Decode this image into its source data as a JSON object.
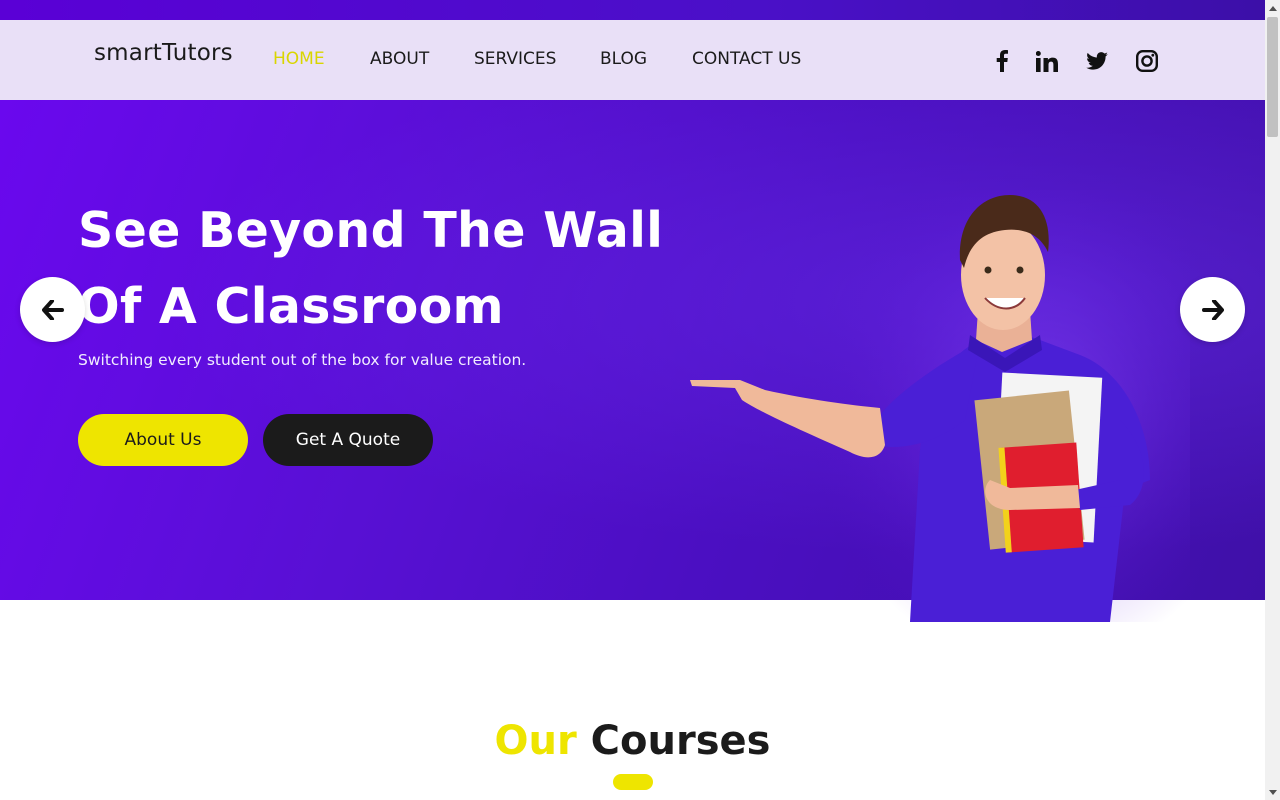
{
  "brand": {
    "name": "smartTutors"
  },
  "nav": {
    "items": [
      {
        "label": "HOME",
        "active": true
      },
      {
        "label": "ABOUT",
        "active": false
      },
      {
        "label": "SERVICES",
        "active": false
      },
      {
        "label": "BLOG",
        "active": false
      },
      {
        "label": "CONTACT US",
        "active": false
      }
    ]
  },
  "social": {
    "icons": [
      "facebook-icon",
      "linkedin-icon",
      "twitter-icon",
      "instagram-icon"
    ]
  },
  "hero": {
    "title_line1": "See Beyond The Wall",
    "title_line2": "Of A Classroom",
    "subtitle": "Switching every student out of the box for value creation.",
    "primary_button": "About Us",
    "secondary_button": "Get A Quote",
    "prev_icon": "arrow-left-icon",
    "next_icon": "arrow-right-icon"
  },
  "courses": {
    "title_highlight": "Our",
    "title_rest": "Courses"
  },
  "colors": {
    "accent": "#eee500",
    "hero_purple": "#5810d4",
    "nav_bg": "#e9e0f7",
    "dark": "#1b1b1b"
  }
}
